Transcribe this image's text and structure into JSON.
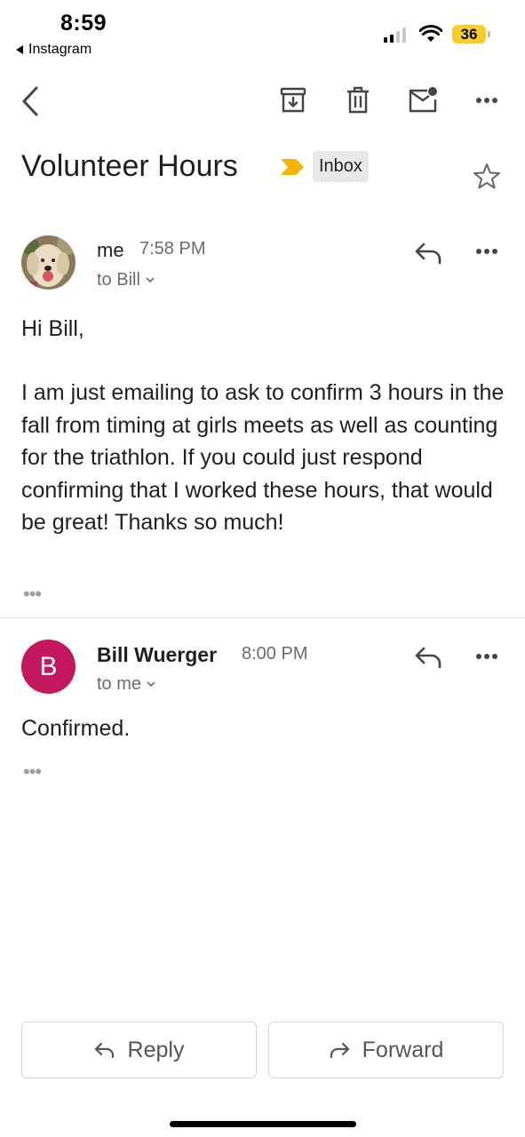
{
  "status_bar": {
    "time": "8:59",
    "back_app": "Instagram",
    "battery": "36"
  },
  "toolbar": {
    "icons": [
      "back-icon",
      "archive-icon",
      "trash-icon",
      "mark-unread-icon",
      "more-icon"
    ]
  },
  "email": {
    "subject": "Volunteer Hours",
    "label": "Inbox",
    "important_color": "#f4b400"
  },
  "messages": [
    {
      "sender": "me",
      "time": "7:58 PM",
      "to": "to Bill",
      "body_greeting": "Hi Bill,",
      "body_paragraph": "I am just emailing to ask to confirm 3 hours in the fall from timing at girls meets as well as counting for the triathlon. If you could just respond confirming that I worked these hours, that would be great! Thanks so much!",
      "ellipsis": "•••"
    },
    {
      "sender": "Bill Wuerger",
      "avatar_letter": "B",
      "avatar_color": "#c3185d",
      "time": "8:00 PM",
      "to": "to me",
      "body": "Confirmed.",
      "ellipsis": "•••"
    }
  ],
  "actions": {
    "reply_label": "Reply",
    "forward_label": "Forward"
  }
}
